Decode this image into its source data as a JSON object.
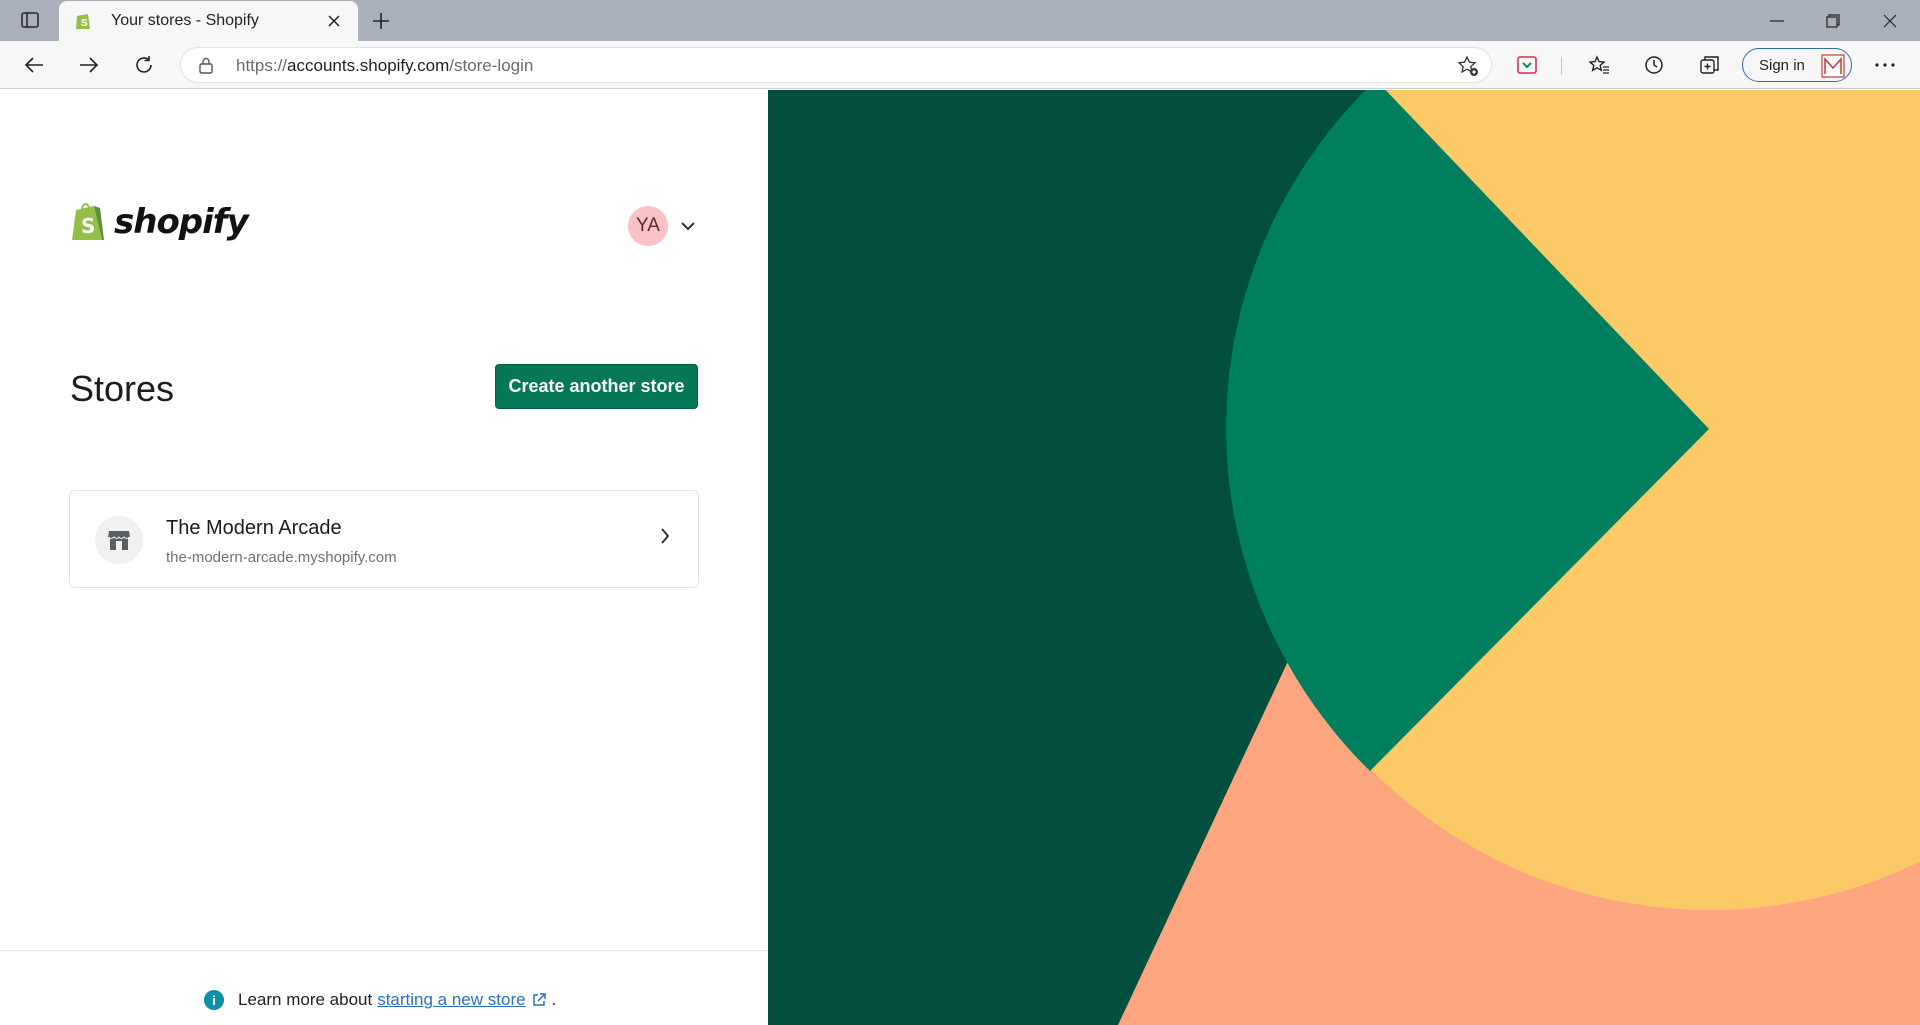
{
  "browser": {
    "tab_title": "Your stores - Shopify",
    "url_prefix": "https://",
    "url_host": "accounts.shopify.com",
    "url_path": "/store-login",
    "signin_label": "Sign in"
  },
  "header": {
    "logo_text": "shopify",
    "user_initials": "YA"
  },
  "main": {
    "title": "Stores",
    "create_button_label": "Create another store",
    "stores": [
      {
        "name": "The Modern Arcade",
        "domain": "the-modern-arcade.myshopify.com"
      }
    ]
  },
  "footer": {
    "text": "Learn more about",
    "link_text": "starting a new store",
    "trailing": "."
  },
  "colors": {
    "brand_green": "#047857",
    "dark_green": "#024f40",
    "mid_green": "#007f5f",
    "yellow": "#fbc966",
    "salmon": "#fca57f",
    "avatar_pink": "#fac1c6"
  }
}
